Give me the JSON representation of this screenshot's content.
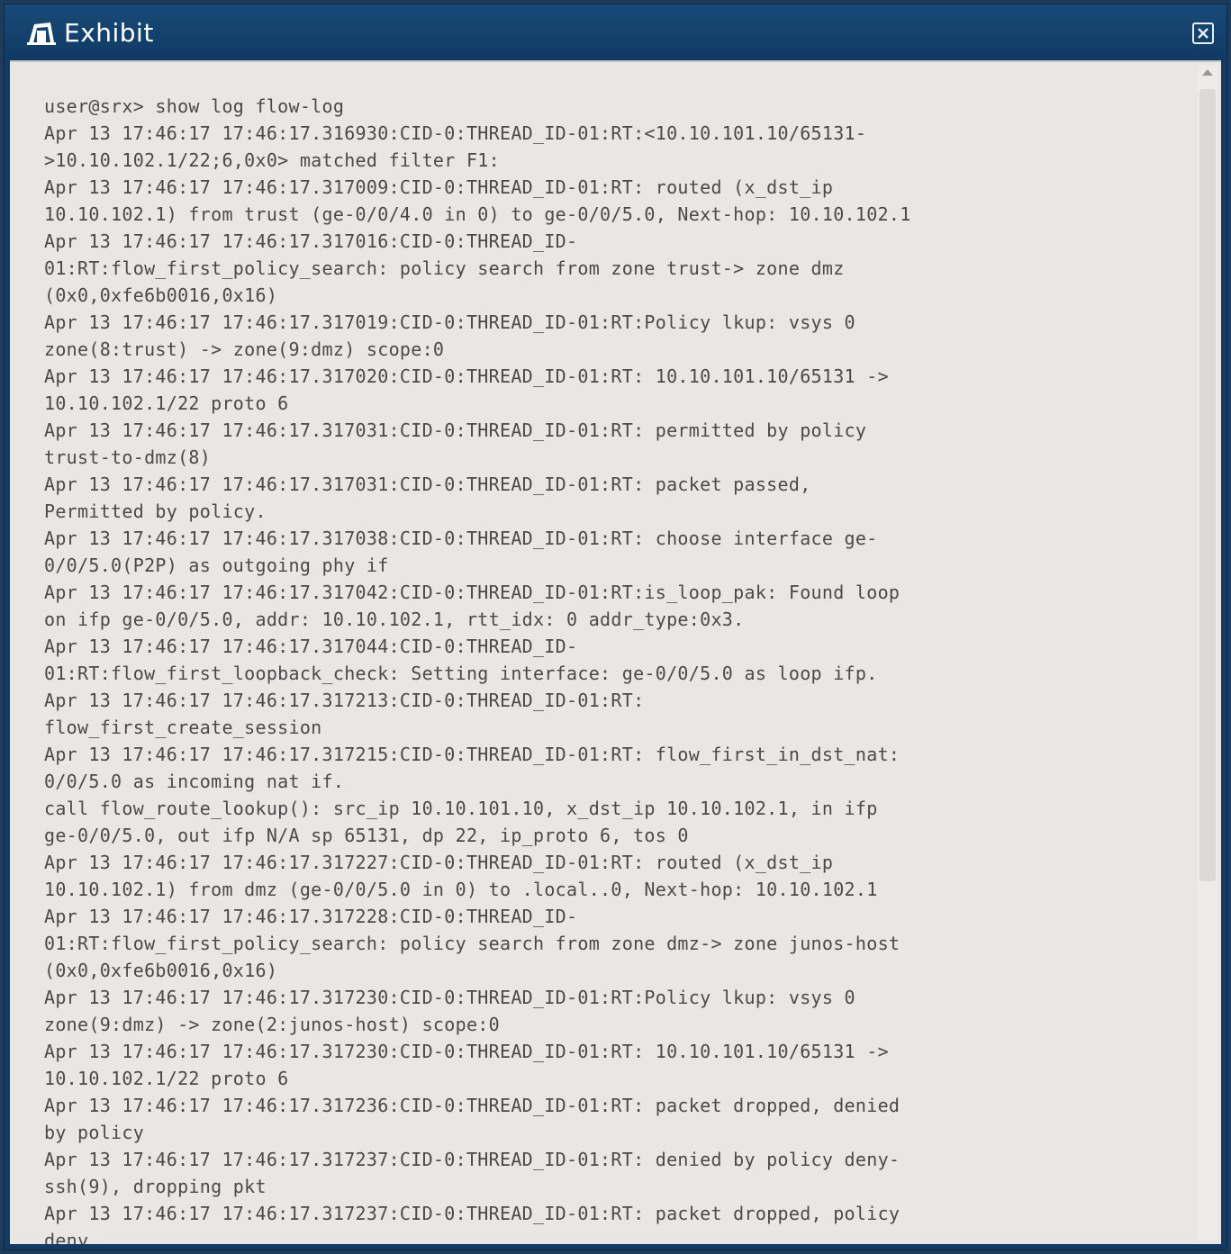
{
  "window": {
    "title": "Exhibit",
    "title_icon": "exhibit-icon",
    "close_icon": "close-icon"
  },
  "log": {
    "lines": [
      "user@srx> show log flow-log",
      "Apr 13 17:46:17 17:46:17.316930:CID-0:THREAD_ID-01:RT:<10.10.101.10/65131-",
      ">10.10.102.1/22;6,0x0> matched filter F1:",
      "Apr 13 17:46:17 17:46:17.317009:CID-0:THREAD_ID-01:RT: routed (x_dst_ip",
      "10.10.102.1) from trust (ge-0/0/4.0 in 0) to ge-0/0/5.0, Next-hop: 10.10.102.1",
      "Apr 13 17:46:17 17:46:17.317016:CID-0:THREAD_ID-",
      "01:RT:flow_first_policy_search: policy search from zone trust-> zone dmz",
      "(0x0,0xfe6b0016,0x16)",
      "Apr 13 17:46:17 17:46:17.317019:CID-0:THREAD_ID-01:RT:Policy lkup: vsys 0",
      "zone(8:trust) -> zone(9:dmz) scope:0",
      "Apr 13 17:46:17 17:46:17.317020:CID-0:THREAD_ID-01:RT: 10.10.101.10/65131 ->",
      "10.10.102.1/22 proto 6",
      "Apr 13 17:46:17 17:46:17.317031:CID-0:THREAD_ID-01:RT: permitted by policy",
      "trust-to-dmz(8)",
      "Apr 13 17:46:17 17:46:17.317031:CID-0:THREAD_ID-01:RT: packet passed,",
      "Permitted by policy.",
      "Apr 13 17:46:17 17:46:17.317038:CID-0:THREAD_ID-01:RT: choose interface ge-",
      "0/0/5.0(P2P) as outgoing phy if",
      "Apr 13 17:46:17 17:46:17.317042:CID-0:THREAD_ID-01:RT:is_loop_pak: Found loop",
      "on ifp ge-0/0/5.0, addr: 10.10.102.1, rtt_idx: 0 addr_type:0x3.",
      "Apr 13 17:46:17 17:46:17.317044:CID-0:THREAD_ID-",
      "01:RT:flow_first_loopback_check: Setting interface: ge-0/0/5.0 as loop ifp.",
      "Apr 13 17:46:17 17:46:17.317213:CID-0:THREAD_ID-01:RT:",
      "flow_first_create_session",
      "Apr 13 17:46:17 17:46:17.317215:CID-0:THREAD_ID-01:RT: flow_first_in_dst_nat:",
      "0/0/5.0 as incoming nat if.",
      "call flow_route_lookup(): src_ip 10.10.101.10, x_dst_ip 10.10.102.1, in ifp",
      "ge-0/0/5.0, out ifp N/A sp 65131, dp 22, ip_proto 6, tos 0",
      "Apr 13 17:46:17 17:46:17.317227:CID-0:THREAD_ID-01:RT: routed (x_dst_ip",
      "10.10.102.1) from dmz (ge-0/0/5.0 in 0) to .local..0, Next-hop: 10.10.102.1",
      "Apr 13 17:46:17 17:46:17.317228:CID-0:THREAD_ID-",
      "01:RT:flow_first_policy_search: policy search from zone dmz-> zone junos-host",
      "(0x0,0xfe6b0016,0x16)",
      "Apr 13 17:46:17 17:46:17.317230:CID-0:THREAD_ID-01:RT:Policy lkup: vsys 0",
      "zone(9:dmz) -> zone(2:junos-host) scope:0",
      "Apr 13 17:46:17 17:46:17.317230:CID-0:THREAD_ID-01:RT: 10.10.101.10/65131 ->",
      "10.10.102.1/22 proto 6",
      "Apr 13 17:46:17 17:46:17.317236:CID-0:THREAD_ID-01:RT: packet dropped, denied",
      "by policy",
      "Apr 13 17:46:17 17:46:17.317237:CID-0:THREAD_ID-01:RT: denied by policy deny-",
      "ssh(9), dropping pkt",
      "Apr 13 17:46:17 17:46:17.317237:CID-0:THREAD_ID-01:RT: packet dropped, policy",
      "deny."
    ]
  },
  "colors": {
    "titlebar": "#123a63",
    "content_bg": "#e9e6e4",
    "log_text": "#4a4a4a"
  }
}
